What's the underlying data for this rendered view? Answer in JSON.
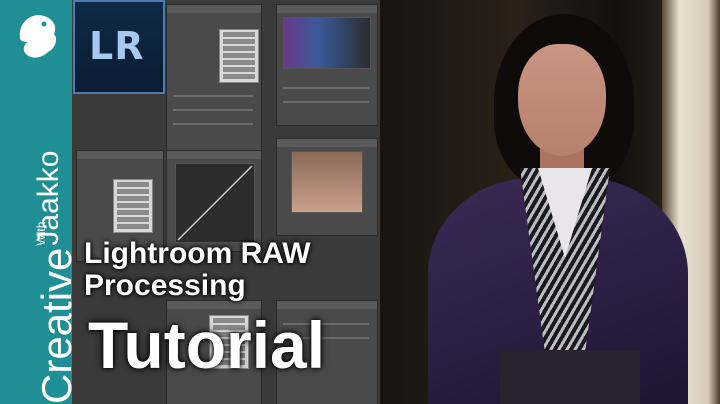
{
  "brand": {
    "creative": "Creative",
    "with": "With",
    "jaakko": "Jaakko"
  },
  "lr_logo": {
    "text": "LR"
  },
  "title": {
    "line1": "Lightroom RAW",
    "line2": "Processing",
    "line3": "Tutorial"
  },
  "colors": {
    "brand_teal": "#1f8f95",
    "lr_blue": "#0e2a47",
    "lr_text": "#a8c8f0",
    "title_text": "#ffffff"
  },
  "icons": {
    "logo_bird": "bird-icon"
  }
}
